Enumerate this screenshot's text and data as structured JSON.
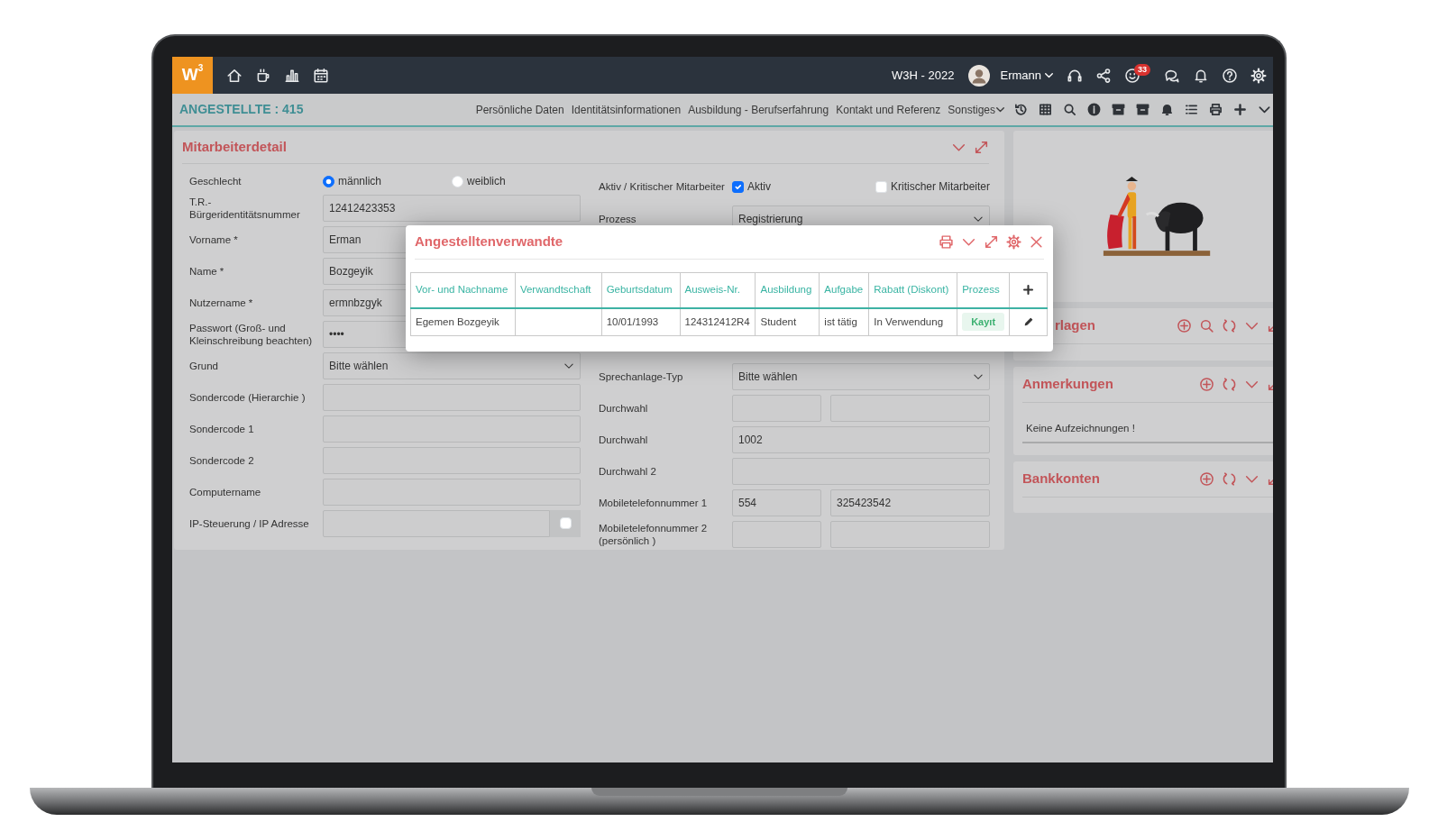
{
  "header": {
    "logo": "W$^{3}$",
    "period": "W3H - 2022",
    "user": "Ermann",
    "notification_count": "33"
  },
  "subheader": {
    "title": "ANGESTELLTE : 415",
    "links": [
      "Persönliche Daten",
      "Identitätsinformationen",
      "Ausbildung - Berufserfahrung",
      "Kontakt und Referenz"
    ],
    "more": "Sonstiges"
  },
  "detail": {
    "title": "Mitarbeiterdetail",
    "left_fields": [
      {
        "kind": "radio",
        "label": "Geschlecht",
        "options": [
          {
            "label": "männlich",
            "selected": true
          },
          {
            "label": "weiblich",
            "selected": false
          }
        ]
      },
      {
        "kind": "text",
        "label": "T.R.-Bürgeridentitätsnummer",
        "value": "12412423353"
      },
      {
        "kind": "text",
        "label": "Vorname *",
        "value": "Erman"
      },
      {
        "kind": "text",
        "label": "Name *",
        "value": "Bozgeyik"
      },
      {
        "kind": "text",
        "label": "Nutzername *",
        "value": "ermnbzgyk"
      },
      {
        "kind": "text",
        "label": "Passwort (Groß- und Kleinschreibung beachten)",
        "value": "••••"
      },
      {
        "kind": "select",
        "label": "Grund",
        "value": "Bitte wählen"
      },
      {
        "kind": "text",
        "label": "Sondercode (Hierarchie )"
      },
      {
        "kind": "text",
        "label": "Sondercode 1"
      },
      {
        "kind": "text",
        "label": "Sondercode 2"
      },
      {
        "kind": "text",
        "label": "Computername"
      },
      {
        "kind": "ip",
        "label": "IP-Steuerung / IP Adresse",
        "checked": false
      }
    ],
    "right_fields": [
      {
        "kind": "checks",
        "label": "Aktiv / Kritischer Mitarbeiter",
        "options": [
          {
            "label": "Aktiv",
            "checked": true
          },
          {
            "label": "Kritischer Mitarbeiter",
            "checked": false
          }
        ]
      },
      {
        "kind": "select",
        "label": "Prozess",
        "value": "Registrierung"
      },
      {
        "kind": "select",
        "label": "Sprechanlage-Typ",
        "value": "Bitte wählen"
      },
      {
        "kind": "pair",
        "label": "Durchwahl"
      },
      {
        "kind": "text",
        "label": "Durchwahl",
        "value": "1002"
      },
      {
        "kind": "text",
        "label": "Durchwahl 2"
      },
      {
        "kind": "pair",
        "label": "Mobiletelefonnummer 1",
        "values": [
          "554",
          "325423542"
        ]
      },
      {
        "kind": "pair",
        "label": "Mobiletelefonnummer 2 (persönlich )"
      }
    ]
  },
  "side": [
    {
      "kind": "documents",
      "title": "rlagen"
    },
    {
      "kind": "notes",
      "title": "Anmerkungen",
      "empty_text": "Keine Aufzeichnungen !"
    },
    {
      "kind": "accounts",
      "title": "Bankkonten"
    }
  ],
  "modal": {
    "title": "Angestelltenverwandte",
    "columns": [
      "Vor- und Nachname",
      "Verwandtschaft",
      "Geburtsdatum",
      "Ausweis-Nr.",
      "Ausbildung",
      "Aufgabe",
      "Rabatt (Diskont)",
      "Prozess"
    ],
    "rows": [
      {
        "cells": [
          "Egemen Bozgeyik",
          "",
          "10/01/1993",
          "124312412R4",
          "Student",
          "ist tätig",
          "In Verwendung"
        ],
        "status": "Kayıt"
      }
    ]
  }
}
